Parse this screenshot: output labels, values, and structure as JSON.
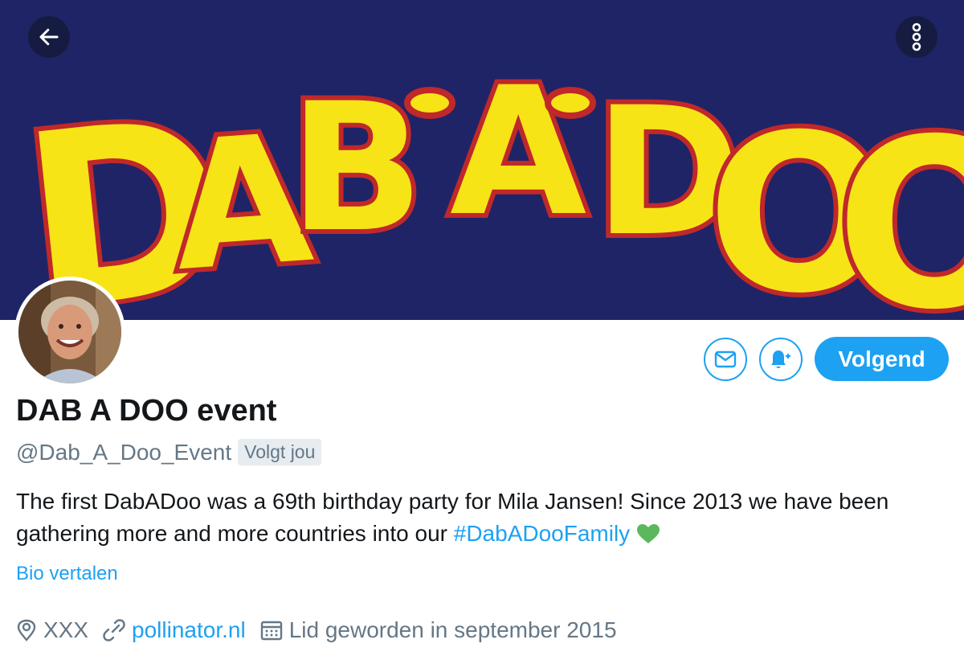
{
  "header": {
    "banner_logo_text": "DAB-A-DOO",
    "banner_colors": {
      "background": "#1f2466",
      "letter_fill": "#f7e417",
      "letter_outline": "#c0282a"
    },
    "back_icon": "arrow-left-icon",
    "more_icon": "more-vertical-icon"
  },
  "profile": {
    "display_name": "DAB A DOO event",
    "handle": "@Dab_A_Doo_Event",
    "follows_you": "Volgt jou",
    "bio_text": "The first DabADoo was a 69th birthday party for Mila Jansen! Since 2013 we have been gathering more and more countries into our ",
    "bio_hashtag": "#DabADooFamily",
    "bio_emoji": "green-heart-icon",
    "translate_label": "Bio vertalen"
  },
  "actions": {
    "message_icon": "envelope-icon",
    "notify_icon": "bell-plus-icon",
    "follow_label": "Volgend"
  },
  "meta": {
    "location": "XXX",
    "website": "pollinator.nl",
    "joined": "Lid geworden in september 2015"
  },
  "colors": {
    "accent": "#1da1f2",
    "muted": "#657786",
    "heart": "#5cb85c"
  }
}
